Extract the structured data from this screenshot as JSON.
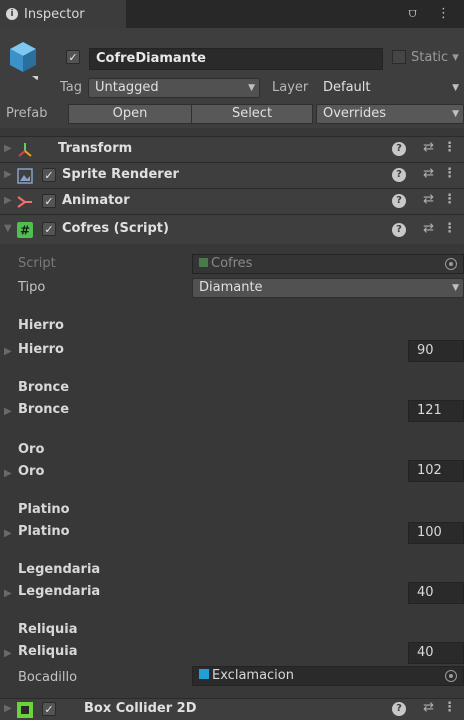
{
  "window": {
    "tab_title": "Inspector",
    "tab_icons": "⩌ ⋮"
  },
  "header": {
    "object_name": "CofreDiamante",
    "static_label": "Static",
    "tag_label": "Tag",
    "tag_value": "Untagged",
    "layer_label": "Layer",
    "layer_value": "Default",
    "prefab_label": "Prefab",
    "open_label": "Open",
    "select_label": "Select",
    "overrides_label": "Overrides"
  },
  "components": [
    {
      "name": "Transform",
      "icon": "transform-icon",
      "has_checkbox": false
    },
    {
      "name": "Sprite Renderer",
      "icon": "sprite-renderer-icon",
      "has_checkbox": true
    },
    {
      "name": "Animator",
      "icon": "animator-icon",
      "has_checkbox": true
    },
    {
      "name": "Cofres (Script)",
      "icon": "script-icon",
      "has_checkbox": true,
      "expanded": true
    },
    {
      "name": "Box Collider 2D",
      "icon": "box-collider-icon",
      "has_checkbox": true
    }
  ],
  "script": {
    "script_label": "Script",
    "script_value": "Cofres",
    "tipo_label": "Tipo",
    "tipo_value": "Diamante",
    "fields": [
      {
        "header": "Hierro",
        "label": "Hierro",
        "value": "90"
      },
      {
        "header": "Bronce",
        "label": "Bronce",
        "value": "121"
      },
      {
        "header": "Oro",
        "label": "Oro",
        "value": "102"
      },
      {
        "header": "Platino",
        "label": "Platino",
        "value": "100"
      },
      {
        "header": "Legendaria",
        "label": "Legendaria",
        "value": "40"
      },
      {
        "header": "Reliquia",
        "label": "Reliquia",
        "value": "40"
      }
    ],
    "bocadillo_label": "Bocadillo",
    "bocadillo_value": "Exclamacion"
  },
  "colors": {
    "accent_green": "#4fc04f",
    "script_blue": "#1fa0d8"
  }
}
